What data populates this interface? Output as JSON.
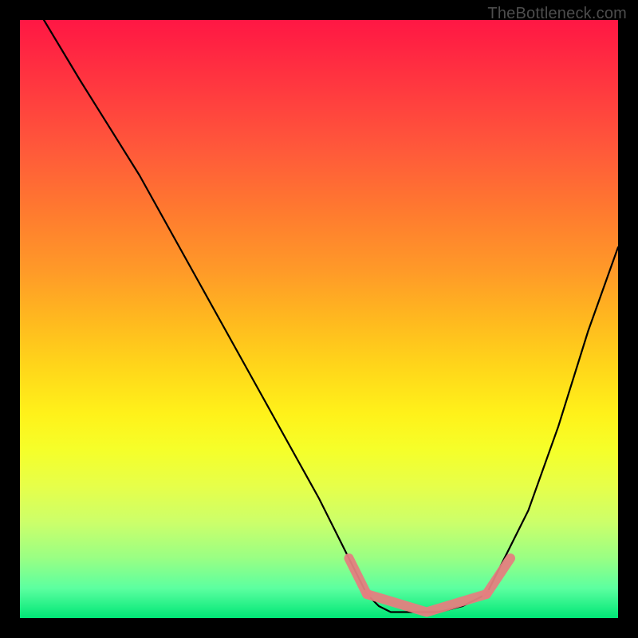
{
  "attribution": "TheBottleneck.com",
  "chart_data": {
    "type": "line",
    "title": "",
    "xlabel": "",
    "ylabel": "",
    "xlim": [
      0,
      100
    ],
    "ylim": [
      0,
      100
    ],
    "series": [
      {
        "name": "curve",
        "x": [
          4,
          10,
          20,
          30,
          40,
          50,
          55,
          58,
          60,
          62,
          66,
          70,
          74,
          78,
          80,
          85,
          90,
          95,
          100
        ],
        "y": [
          100,
          90,
          74,
          56,
          38,
          20,
          10,
          4,
          2,
          1,
          1,
          1,
          2,
          4,
          8,
          18,
          32,
          48,
          62
        ]
      }
    ],
    "annotations": [
      {
        "name": "left-marker",
        "x_range": [
          55,
          58
        ],
        "y_range": [
          10,
          4
        ]
      },
      {
        "name": "bottom-marker",
        "x_range": [
          58,
          78
        ],
        "y_range": [
          4,
          1,
          4
        ]
      },
      {
        "name": "right-marker",
        "x_range": [
          78,
          82
        ],
        "y_range": [
          4,
          10
        ]
      }
    ],
    "background": {
      "type": "vertical-gradient",
      "stops": [
        {
          "pos": 0,
          "color": "#ff1744"
        },
        {
          "pos": 50,
          "color": "#ffd61a"
        },
        {
          "pos": 80,
          "color": "#e6ff4a"
        },
        {
          "pos": 100,
          "color": "#00e676"
        }
      ]
    }
  }
}
